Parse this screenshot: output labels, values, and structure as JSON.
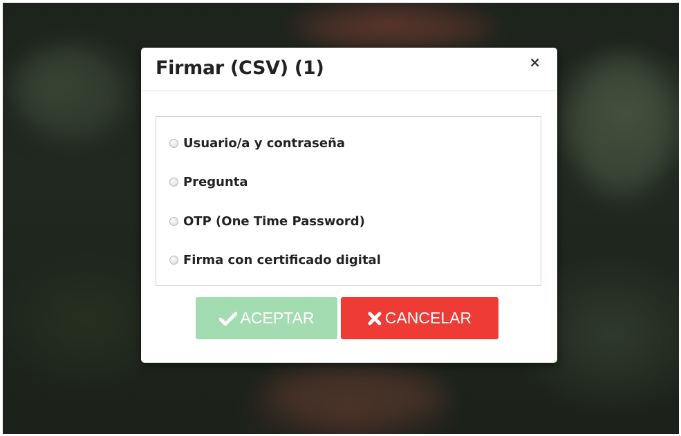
{
  "dialog": {
    "title": "Firmar (CSV) (1)",
    "close_glyph": "×",
    "options": [
      {
        "label": "Usuario/a y contraseña",
        "selected": false
      },
      {
        "label": "Pregunta",
        "selected": false
      },
      {
        "label": "OTP (One Time Password)",
        "selected": false
      },
      {
        "label": "Firma con certificado digital",
        "selected": false
      }
    ],
    "accept": {
      "label": "ACEPTAR",
      "icon": "check-icon",
      "enabled": false,
      "color": "#a4dcb2"
    },
    "cancel": {
      "label": "CANCELAR",
      "icon": "x-icon",
      "enabled": true,
      "color": "#ef3b36"
    }
  }
}
